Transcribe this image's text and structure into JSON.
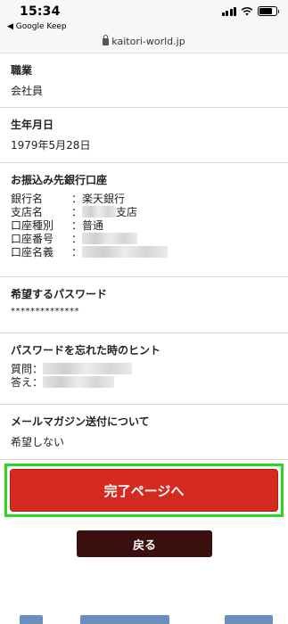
{
  "status_bar": {
    "time": "15:34",
    "back_app": "◀ Google Keep"
  },
  "browser": {
    "url": "kaitori-world.jp"
  },
  "sections": {
    "occupation": {
      "title": "職業",
      "value": "会社員"
    },
    "birthday": {
      "title": "生年月日",
      "value": "1979年5月28日"
    },
    "bank": {
      "title": "お振込み先銀行口座",
      "rows": [
        {
          "label": "銀行名",
          "value": "：楽天銀行"
        },
        {
          "label": "支店名",
          "value": "：",
          "suffix": "支店"
        },
        {
          "label": "口座種別",
          "value": "：普通"
        },
        {
          "label": "口座番号",
          "value": "："
        },
        {
          "label": "口座名義",
          "value": "："
        }
      ]
    },
    "password": {
      "title": "希望するパスワード",
      "value": "**************"
    },
    "hint": {
      "title": "パスワードを忘れた時のヒント",
      "rows": [
        {
          "label": "質問："
        },
        {
          "label": "答え："
        }
      ]
    },
    "mail": {
      "title": "メールマガジン送付について",
      "value": "希望しない"
    }
  },
  "buttons": {
    "complete": "完了ページへ",
    "back": "戻る"
  }
}
